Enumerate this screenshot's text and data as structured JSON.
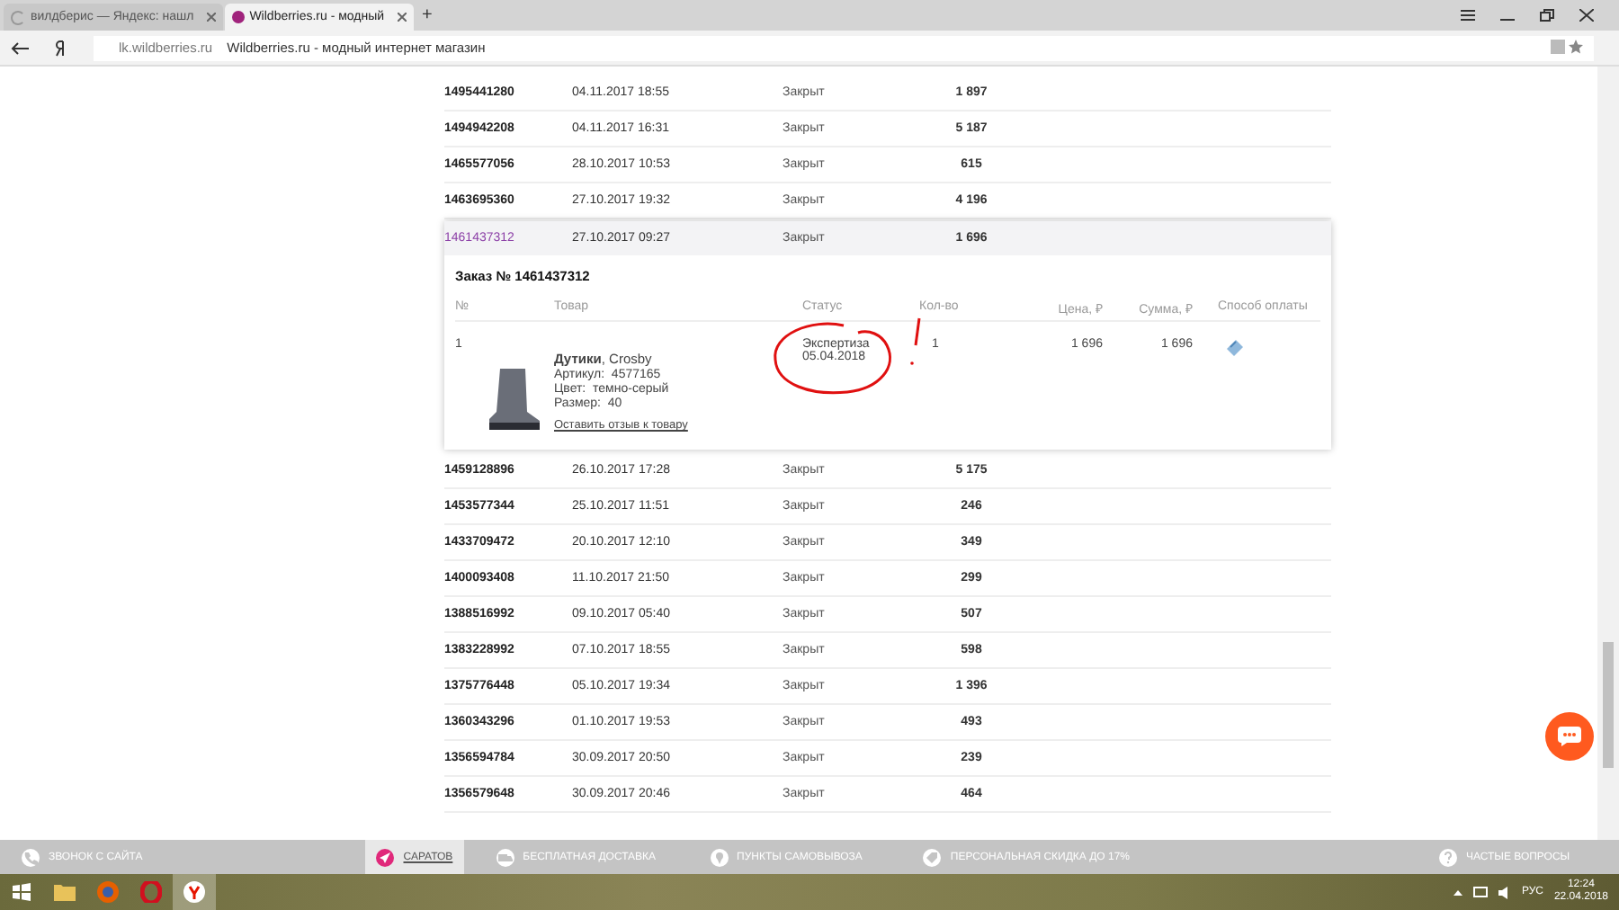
{
  "browser": {
    "tabs": [
      {
        "title": "вилдберис — Яндекс: нашл",
        "selected": false,
        "loading": true
      },
      {
        "title": "Wildberries.ru - модный",
        "selected": true,
        "loading": false
      }
    ],
    "new_tab": "+",
    "address": {
      "domain": "lk.wildberries.ru",
      "title": "Wildberries.ru - модный интернет магазин"
    }
  },
  "orders": [
    {
      "id": "1495441280",
      "date": "04.11.2017 18:55",
      "status": "Закрыт",
      "amount": "1 897",
      "expanded": false
    },
    {
      "id": "1494942208",
      "date": "04.11.2017 16:31",
      "status": "Закрыт",
      "amount": "5 187",
      "expanded": false
    },
    {
      "id": "1465577056",
      "date": "28.10.2017 10:53",
      "status": "Закрыт",
      "amount": "615",
      "expanded": false
    },
    {
      "id": "1463695360",
      "date": "27.10.2017 19:32",
      "status": "Закрыт",
      "amount": "4 196",
      "expanded": false
    },
    {
      "id": "1461437312",
      "date": "27.10.2017 09:27",
      "status": "Закрыт",
      "amount": "1 696",
      "expanded": true,
      "detail": {
        "title": "Заказ № 1461437312",
        "columns": [
          "№",
          "Товар",
          "Статус",
          "Кол-во",
          "Цена, ₽",
          "Сумма, ₽",
          "Способ оплаты"
        ],
        "items": [
          {
            "num": "1",
            "name": "**Дутики**, Crosby",
            "lines": [
              "Артикул:  4577165",
              "Цвет:  темно-серый",
              "Размер:  40"
            ],
            "review_link": "Оставить отзыв к товару",
            "status": "Экспертиза",
            "status_date": "05.04.2018",
            "qty": "1",
            "price": "1 696",
            "sum": "1 696"
          }
        ]
      }
    },
    {
      "id": "1459128896",
      "date": "26.10.2017 17:28",
      "status": "Закрыт",
      "amount": "5 175",
      "expanded": false
    },
    {
      "id": "1453577344",
      "date": "25.10.2017 11:51",
      "status": "Закрыт",
      "amount": "246",
      "expanded": false
    },
    {
      "id": "1433709472",
      "date": "20.10.2017 12:10",
      "status": "Закрыт",
      "amount": "349",
      "expanded": false
    },
    {
      "id": "1400093408",
      "date": "11.10.2017 21:50",
      "status": "Закрыт",
      "amount": "299",
      "expanded": false
    },
    {
      "id": "1388516992",
      "date": "09.10.2017 05:40",
      "status": "Закрыт",
      "amount": "507",
      "expanded": false
    },
    {
      "id": "1383228992",
      "date": "07.10.2017 18:55",
      "status": "Закрыт",
      "amount": "598",
      "expanded": false
    },
    {
      "id": "1375776448",
      "date": "05.10.2017 19:34",
      "status": "Закрыт",
      "amount": "1 396",
      "expanded": false
    },
    {
      "id": "1360343296",
      "date": "01.10.2017 19:53",
      "status": "Закрыт",
      "amount": "493",
      "expanded": false
    },
    {
      "id": "1356594784",
      "date": "30.09.2017 20:50",
      "status": "Закрыт",
      "amount": "239",
      "expanded": false
    },
    {
      "id": "1356579648",
      "date": "30.09.2017 20:46",
      "status": "Закрыт",
      "amount": "464",
      "expanded": false
    }
  ],
  "footer": [
    {
      "label": "ЗВОНОК С САЙТА",
      "kind": "phone",
      "selected": false
    },
    {
      "label": "САРАТОВ",
      "kind": "location",
      "selected": true
    },
    {
      "label": "БЕСПЛАТНАЯ ДОСТАВКА",
      "kind": "truck",
      "selected": false
    },
    {
      "label": "ПУНКТЫ САМОВЫВОЗА",
      "kind": "pin",
      "selected": false
    },
    {
      "label": "ПЕРСОНАЛЬНАЯ СКИДКА ДО 17%",
      "kind": "discount",
      "selected": false
    },
    {
      "label": "ЧАСТЫЕ ВОПРОСЫ",
      "kind": "help",
      "selected": false
    }
  ],
  "taskbar": {
    "language": "РУС",
    "time": "12:24",
    "date": "22.04.2018"
  }
}
